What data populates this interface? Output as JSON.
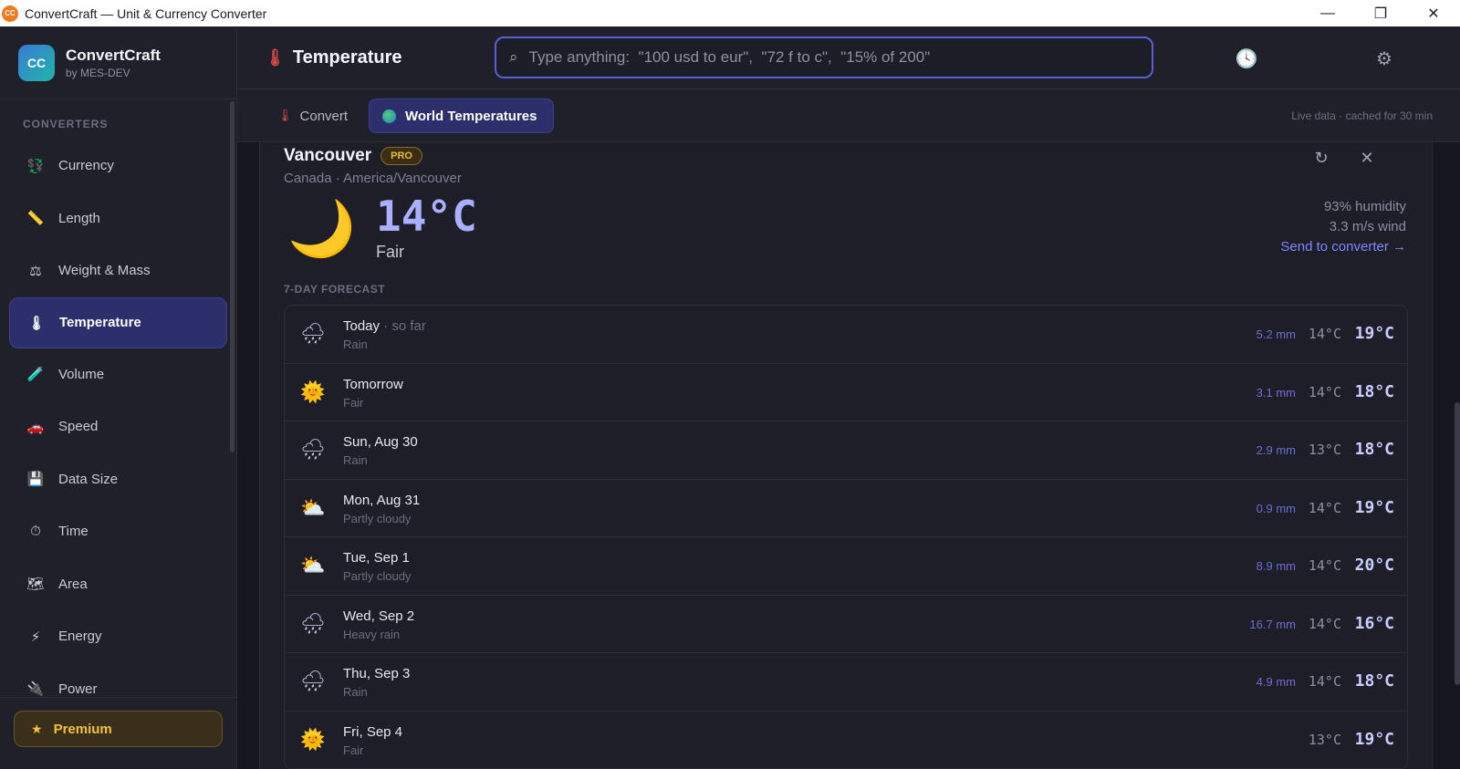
{
  "window": {
    "title": "ConvertCraft — Unit & Currency Converter",
    "logo_text": "CC",
    "controls": [
      "—",
      "❐",
      "✕"
    ]
  },
  "brand": {
    "logo": "CC",
    "name": "ConvertCraft",
    "sub": "by MES-DEV"
  },
  "sidebar": {
    "section_label": "CONVERTERS",
    "items": [
      {
        "label": "Currency",
        "icon": "currency-icon",
        "glyph": "💱"
      },
      {
        "label": "Length",
        "icon": "ruler-icon",
        "glyph": "📏"
      },
      {
        "label": "Weight & Mass",
        "icon": "scale-icon",
        "glyph": "⚖"
      },
      {
        "label": "Temperature",
        "icon": "thermometer-icon",
        "glyph": "🌡"
      },
      {
        "label": "Volume",
        "icon": "test-tube-icon",
        "glyph": "🧪"
      },
      {
        "label": "Speed",
        "icon": "car-icon",
        "glyph": "🚗"
      },
      {
        "label": "Data Size",
        "icon": "floppy-disk-icon",
        "glyph": "💾"
      },
      {
        "label": "Time",
        "icon": "stopwatch-icon",
        "glyph": "⏱"
      },
      {
        "label": "Area",
        "icon": "map-icon",
        "glyph": "🗺"
      },
      {
        "label": "Energy",
        "icon": "lightning-icon",
        "glyph": "⚡"
      },
      {
        "label": "Power",
        "icon": "plug-icon",
        "glyph": "🔌"
      }
    ],
    "active_index": 3,
    "premium_label": "Premium",
    "premium_icon": "★"
  },
  "header": {
    "title": "Temperature",
    "title_icon": "🌡",
    "search_placeholder": "Type anything:  \"100 usd to eur\",  \"72 f to c\",  \"15% of 200\"",
    "search_icon": "⌕",
    "history_icon": "🕓",
    "settings_icon": "⚙"
  },
  "tabs": {
    "items": [
      {
        "label": "Convert",
        "icon": "thermometer-icon"
      },
      {
        "label": "World Temperatures",
        "icon": "globe-icon"
      }
    ],
    "active": "World Temperatures",
    "live_note": "Live data · cached for 30 min"
  },
  "city": {
    "name": "Vancouver",
    "badge": "PRO",
    "subtitle": "Canada · America/Vancouver",
    "refresh_icon": "↻",
    "close_icon": "✕",
    "current": {
      "icon": "🌙",
      "temp": "14°C",
      "condition": "Fair",
      "humidity": "93% humidity",
      "wind": "3.3 m/s wind",
      "send_link": "Send to converter →"
    }
  },
  "forecast": {
    "label": "7-DAY FORECAST",
    "rows": [
      {
        "day": "Today",
        "suffix": " · so far",
        "cond": "Rain",
        "icon": "rain",
        "glyph": "🌧",
        "precip": "5.2 mm",
        "lo": "14°C",
        "hi": "19°C"
      },
      {
        "day": "Tomorrow",
        "suffix": "",
        "cond": "Fair",
        "icon": "sun",
        "glyph": "🌞",
        "precip": "3.1 mm",
        "lo": "14°C",
        "hi": "18°C"
      },
      {
        "day": "Sun, Aug 30",
        "suffix": "",
        "cond": "Rain",
        "icon": "rain",
        "glyph": "🌧",
        "precip": "2.9 mm",
        "lo": "13°C",
        "hi": "18°C"
      },
      {
        "day": "Mon, Aug 31",
        "suffix": "",
        "cond": "Partly cloudy",
        "icon": "cloud",
        "glyph": "⛅",
        "precip": "0.9 mm",
        "lo": "14°C",
        "hi": "19°C"
      },
      {
        "day": "Tue, Sep 1",
        "suffix": "",
        "cond": "Partly cloudy",
        "icon": "cloud",
        "glyph": "⛅",
        "precip": "8.9 mm",
        "lo": "14°C",
        "hi": "20°C"
      },
      {
        "day": "Wed, Sep 2",
        "suffix": "",
        "cond": "Heavy rain",
        "icon": "rain",
        "glyph": "🌧",
        "precip": "16.7 mm",
        "lo": "14°C",
        "hi": "16°C"
      },
      {
        "day": "Thu, Sep 3",
        "suffix": "",
        "cond": "Rain",
        "icon": "rain",
        "glyph": "🌧",
        "precip": "4.9 mm",
        "lo": "14°C",
        "hi": "18°C"
      },
      {
        "day": "Fri, Sep 4",
        "suffix": "",
        "cond": "Fair",
        "icon": "sun",
        "glyph": "🌞",
        "precip": "",
        "lo": "13°C",
        "hi": "19°C"
      }
    ]
  },
  "colors": {
    "accent": "#5b5fd6",
    "active_bg": "#2c2f6b",
    "premium": "#f5c042",
    "temp": "#aab0ff"
  }
}
